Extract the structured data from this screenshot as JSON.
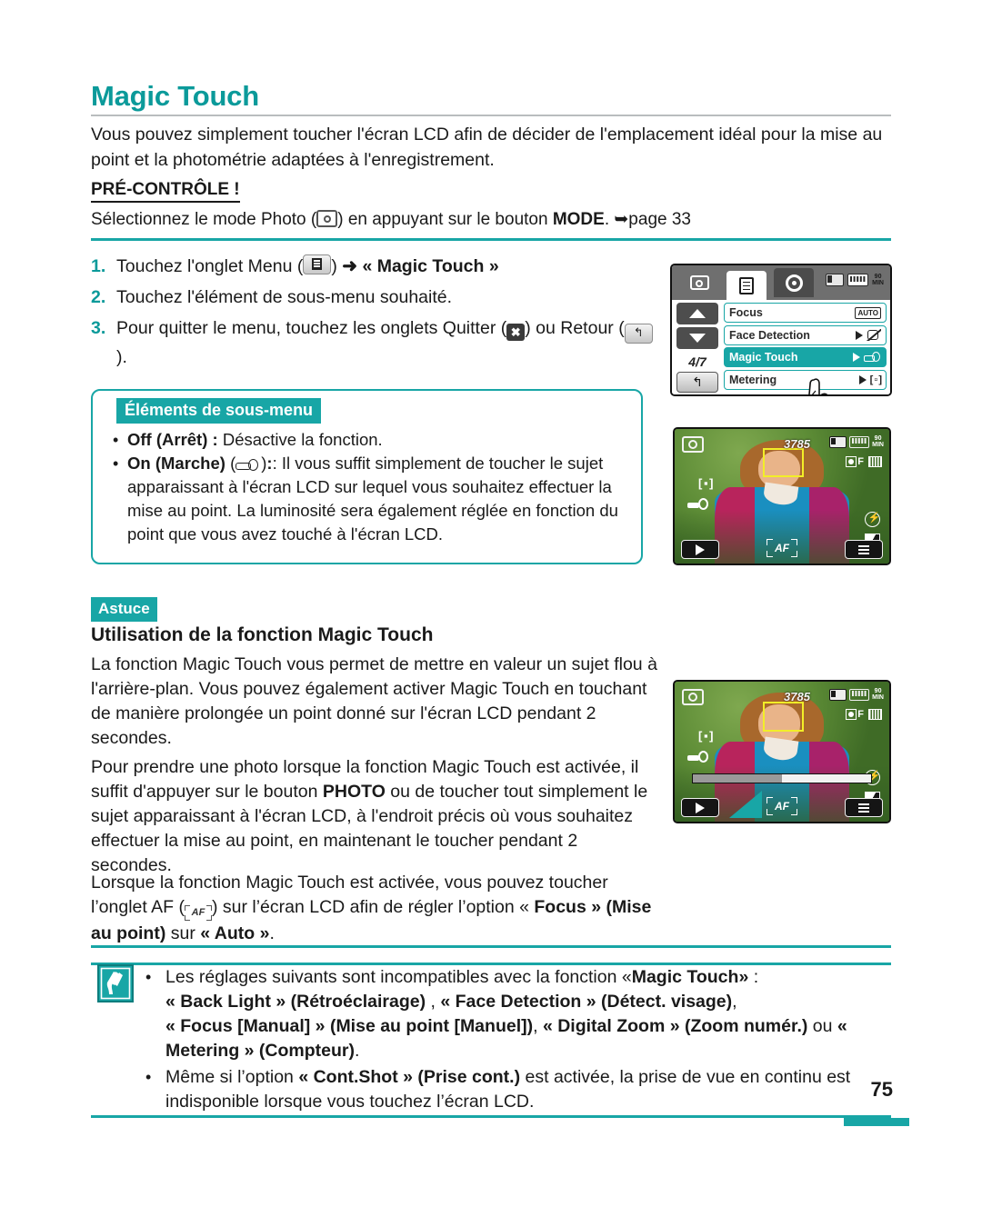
{
  "document": {
    "page_number": "75",
    "title": "Magic Touch",
    "intro": "Vous pouvez simplement toucher l'écran LCD afin de décider de l'emplacement idéal pour la mise au point et la photométrie adaptées à l'enregistrement.",
    "precheck": {
      "label": "PRÉ-CONTRÔLE !",
      "text_before": "Sélectionnez le mode Photo (",
      "icon": "camera-icon",
      "text_after": ") en appuyant sur le bouton ",
      "bold_token": "MODE",
      "page_ref": ". ➥page 33"
    }
  },
  "steps": [
    {
      "number": "1.",
      "text_before": "Touchez l'onglet Menu (",
      "icon": "menu-icon",
      "text_mid": ") ",
      "arrow": "➜",
      "bold_token": " « Magic Touch »",
      "text_after": ""
    },
    {
      "number": "2.",
      "text_before": "Touchez l'élément de sous-menu souhaité.",
      "icon": "",
      "text_mid": "",
      "arrow": "",
      "bold_token": "",
      "text_after": ""
    },
    {
      "number": "3.",
      "text_before": "Pour quitter le menu, touchez les onglets Quitter (",
      "icon": "exit-icon",
      "text_mid": ") ou Retour (",
      "icon2": "back-icon",
      "text_after": ")."
    }
  ],
  "submenu_box": {
    "tag": "Éléments de sous-menu",
    "items": [
      {
        "bold": "Off (Arrêt) :",
        "text": " Désactive la fonction.",
        "icon": ""
      },
      {
        "bold": "On (Marche)",
        "icon": "magic-touch-icon",
        "text": ": Il vous suffit simplement de toucher le sujet apparaissant à l'écran LCD sur lequel vous souhaitez effectuer la mise au point. La luminosité sera également réglée en fonction du point que vous avez touché à l'écran LCD."
      }
    ]
  },
  "tip": {
    "tag": "Astuce",
    "heading": "Utilisation de la fonction Magic Touch",
    "paragraph_1": "La fonction Magic Touch vous permet de mettre en valeur un sujet flou à l'arrière-plan.  Vous pouvez également activer Magic Touch en touchant de manière prolongée un point donné sur l'écran LCD pendant 2 secondes.",
    "paragraph_2_a": "Pour prendre une photo lorsque la fonction Magic Touch est activée, il suffit d'appuyer sur le bouton ",
    "paragraph_2_bold": "PHOTO",
    "paragraph_2_b": " ou de toucher tout simplement le sujet apparaissant à l'écran LCD, à l'endroit précis où vous souhaitez effectuer la mise au point, en maintenant le toucher pendant 2 secondes.",
    "paragraph_3_a": "Lorsque la fonction Magic Touch est activée, vous pouvez toucher l’onglet AF (",
    "paragraph_3_icon": "af-icon",
    "paragraph_3_b": ") sur l’écran LCD afin de régler l’option « ",
    "paragraph_3_bold1": "Focus » (Mise au point)",
    "paragraph_3_c": " sur ",
    "paragraph_3_bold2": "« Auto »",
    "paragraph_3_d": "."
  },
  "note": {
    "icon": "note-pen-icon",
    "bullets": [
      {
        "t1": "Les réglages suivants sont incompatibles avec la fonction «",
        "b1": "Magic Touch»",
        "t2": " :",
        "b2": "« Back Light » (Rétroéclairage)",
        "t3": " , ",
        "b3": "« Face Detection » (Détect. visage)",
        "t4": ", ",
        "b4": "« Focus [Manual] » (Mise au point [Manuel])",
        "t5": ", ",
        "b5": "« Digital Zoom » (Zoom numér.)",
        "t6": " ou ",
        "b6": "« Metering » (Compteur)",
        "t7": "."
      },
      {
        "t1": "Même si l’option ",
        "b1": "« Cont.Shot » (Prise cont.)",
        "t2": " est activée, la prise de vue en continu est indisponible lorsque vous touchez l’écran LCD."
      }
    ]
  },
  "lcd_menu_screen": {
    "tabs": [
      {
        "name": "camera-tab",
        "state": "inactive"
      },
      {
        "name": "menu-tab",
        "state": "active"
      },
      {
        "name": "settings-tab",
        "state": "dark"
      }
    ],
    "status": {
      "card": "memory-card-icon",
      "battery": "battery-icon",
      "time_value": "90",
      "time_unit": "MIN"
    },
    "nav": {
      "up": "▲",
      "down": "▼",
      "counter": "4/7",
      "back": "↰"
    },
    "items": [
      {
        "label": "Focus",
        "right_icon": "auto-badge",
        "right_text": "AUTO",
        "selected": false,
        "has_arrow": false
      },
      {
        "label": "Face Detection",
        "right_icon": "face-detection-off-icon",
        "right_text": "",
        "selected": false,
        "has_arrow": true
      },
      {
        "label": "Magic Touch",
        "right_icon": "magic-touch-icon",
        "right_text": "",
        "selected": true,
        "has_arrow": true
      },
      {
        "label": "Metering",
        "right_icon": "metering-icon",
        "right_text": "[ ▫ ]",
        "selected": false,
        "has_arrow": true
      }
    ],
    "cursor": "hand-pointer-icon"
  },
  "lcd_photo_screen_1": {
    "mode_icon": "photo-mode-icon",
    "counter": "3785",
    "status": {
      "card": "memory-card-icon",
      "battery": "battery-icon",
      "time_value": "90",
      "time_unit": "MIN"
    },
    "quality": "F",
    "resolution_icon": "resolution-icon",
    "metering": "[ ▪ ]",
    "magic_touch_icon": "magic-touch-icon",
    "flash_icon": "flash-off-icon",
    "contrast_icon": "contrast-icon",
    "left_button": "playback-button",
    "center_button": "af-tab",
    "center_label": "AF",
    "right_button": "menu-button",
    "focus_frame": "yellow-focus-frame"
  },
  "lcd_photo_screen_2": {
    "mode_icon": "photo-mode-icon",
    "counter": "3785",
    "status": {
      "card": "memory-card-icon",
      "battery": "battery-icon",
      "time_value": "90",
      "time_unit": "MIN"
    },
    "quality": "F",
    "resolution_icon": "resolution-icon",
    "metering": "[ ▪ ]",
    "magic_touch_icon": "magic-touch-icon",
    "flash_icon": "flash-off-icon",
    "contrast_icon": "contrast-icon",
    "left_button": "playback-button",
    "center_button": "af-tab",
    "center_label": "AF",
    "right_button": "menu-button",
    "focus_frame": "yellow-focus-frame",
    "progress_percent": 50,
    "touch_pointer": "touch-pointer-icon"
  },
  "colors": {
    "teal": "#18a6a6",
    "title_teal": "#0b9a9a",
    "focus_yellow": "#f2ee28",
    "text": "#1a1a1a"
  }
}
